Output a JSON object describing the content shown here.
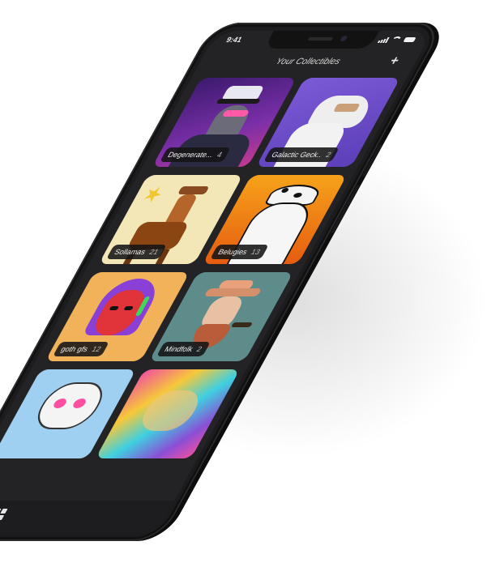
{
  "status_bar": {
    "time": "9:41"
  },
  "header": {
    "title": "Your Collectibles",
    "add_label": "+"
  },
  "collections": [
    {
      "name": "Degenerate...",
      "count": "4"
    },
    {
      "name": "Galactic Geck..",
      "count": "2"
    },
    {
      "name": "Sollamas",
      "count": "21"
    },
    {
      "name": "Belugies",
      "count": "13"
    },
    {
      "name": "goth gfs",
      "count": "12"
    },
    {
      "name": "Mindfolk",
      "count": "2"
    }
  ],
  "bottom_nav": {
    "wallet_label": "$"
  },
  "colors": {
    "screen_bg": "#232325",
    "frame": "#1c1c1e",
    "label_bg": "#141416"
  }
}
